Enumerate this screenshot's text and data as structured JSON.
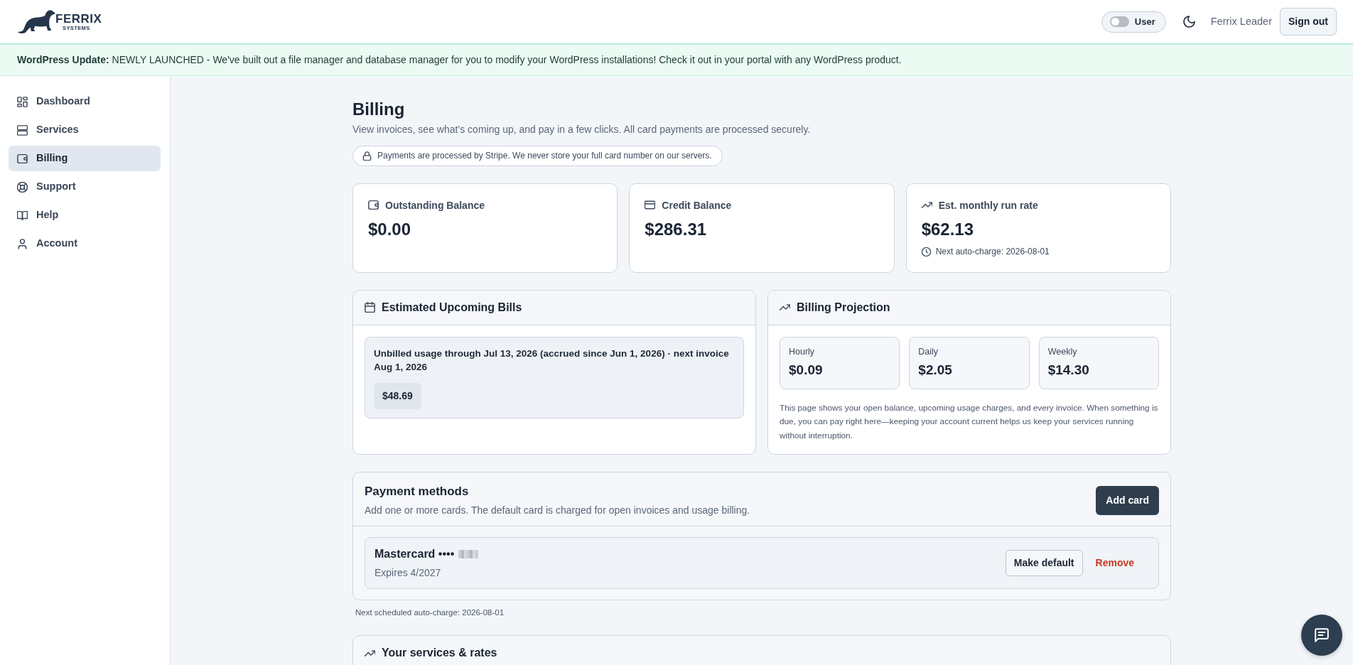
{
  "header": {
    "logo": {
      "name": "FERRIX",
      "tagline": "SYSTEMS"
    },
    "role_toggle": {
      "label": "User",
      "on": false
    },
    "user_name": "Ferrix Leader",
    "sign_out": "Sign out"
  },
  "banner": {
    "text": "**WordPress Update:** NEWLY LAUNCHED - We've built out a file manager and database manager for you to modify your WordPress installations! Check it out in your portal with any WordPress product."
  },
  "sidebar": {
    "items": [
      {
        "label": "Dashboard",
        "selected": false
      },
      {
        "label": "Services",
        "selected": false
      },
      {
        "label": "Billing",
        "selected": true
      },
      {
        "label": "Support",
        "selected": false
      },
      {
        "label": "Help",
        "selected": false
      },
      {
        "label": "Account",
        "selected": false
      }
    ]
  },
  "page": {
    "title": "Billing",
    "subtitle": "View invoices, see what’s coming up, and pay in a few clicks. All card payments are processed securely.",
    "security_note": "Payments are processed by Stripe. We never store your full card number on our servers."
  },
  "summary_cards": [
    {
      "label": "Outstanding Balance",
      "value": "$0.00"
    },
    {
      "label": "Credit Balance",
      "value": "$286.31"
    },
    {
      "label": "Est. monthly run rate",
      "value": "$62.13",
      "note": "Next auto-charge: 2026-08-01"
    }
  ],
  "upcoming_bills": {
    "title": "Estimated Upcoming Bills",
    "items": [
      {
        "description": "Unbilled usage through Jul 13, 2026 (accrued since Jun 1, 2026) · next invoice Aug 1, 2026",
        "amount": "$48.69"
      }
    ]
  },
  "projection": {
    "title": "Billing Projection",
    "rates": [
      {
        "label": "Hourly",
        "value": "$0.09"
      },
      {
        "label": "Daily",
        "value": "$2.05"
      },
      {
        "label": "Weekly",
        "value": "$14.30"
      }
    ],
    "description": "This page shows your open balance, upcoming usage charges, and every invoice. When something is due, you can pay right here—keeping your account current helps us keep your services running without interruption."
  },
  "payment_methods": {
    "title": "Payment methods",
    "subtitle": "Add one or more cards. The default card is charged for open invoices and usage billing.",
    "add_button": "Add card",
    "cards": [
      {
        "label": "Mastercard ••••",
        "number_masked": true,
        "expires": "Expires 4/2027",
        "make_default": "Make default",
        "remove": "Remove"
      }
    ],
    "note": "Next scheduled auto-charge: 2026-08-01"
  },
  "services": {
    "title": "Your services & rates"
  }
}
